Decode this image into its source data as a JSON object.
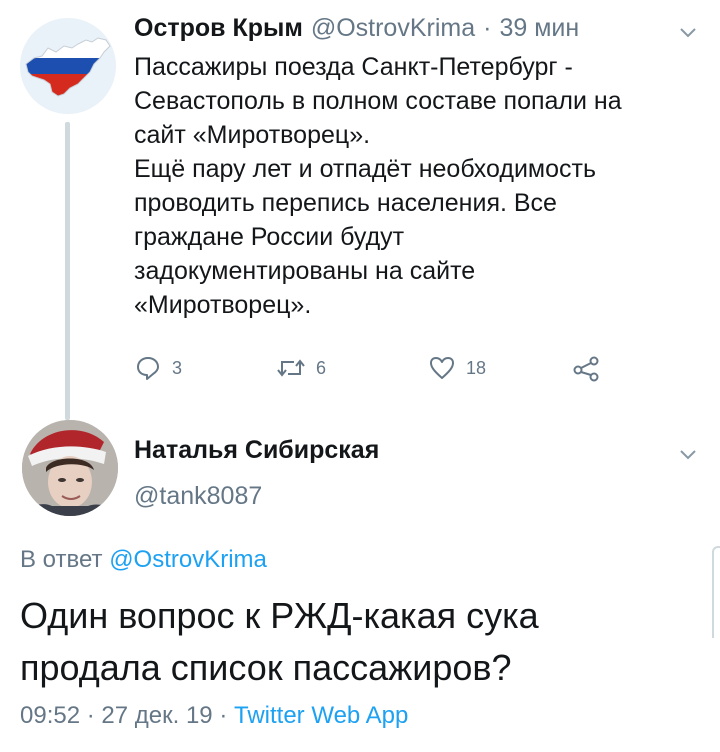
{
  "tweet1": {
    "author_name": "Остров Крым",
    "handle": "@OstrovKrima",
    "separator": "·",
    "time": "39 мин",
    "body_lines": [
      "Пассажиры поезда Санкт-Петербург -",
      "Севастополь в полном составе попали на",
      "сайт «Миротворец».",
      "Ещё пару лет и отпадёт необходимость",
      "проводить перепись населения. Все",
      "граждане России будут",
      "задокументированы на сайте",
      "«Миротворец»."
    ],
    "actions": {
      "reply_count": "3",
      "retweet_count": "6",
      "like_count": "18"
    },
    "avatar_icon": "crimea-flag-map-avatar",
    "colors": {
      "flag_white": "#ffffff",
      "flag_blue": "#1c4fb0",
      "flag_red": "#d52b1e"
    }
  },
  "tweet2": {
    "author_name": "Наталья Сибирская",
    "handle": "@tank8087",
    "avatar_icon": "user-photo-santa-hat",
    "reply_prefix": "В ответ",
    "reply_to": "@OstrovKrima",
    "body_lines": [
      "Один вопрос к РЖД-какая сука",
      "продала список пассажиров?"
    ],
    "time": "09:52",
    "separator": "·",
    "date": "27 дек. 19",
    "source": "Twitter Web App"
  },
  "colors": {
    "text": "#14171a",
    "secondary": "#657786",
    "link": "#1da1f2",
    "divider": "#cfd9de"
  }
}
